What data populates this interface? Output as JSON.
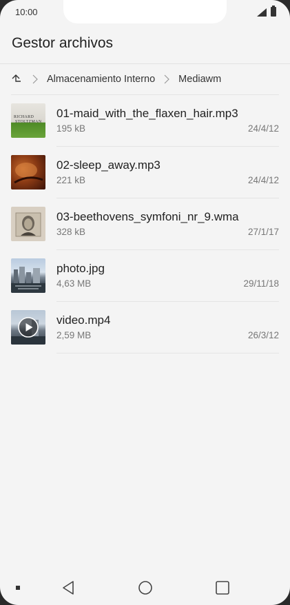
{
  "status": {
    "time": "10:00"
  },
  "header": {
    "title": "Gestor archivos"
  },
  "breadcrumb": {
    "items": [
      "Almacenamiento Interno",
      "Mediawm"
    ]
  },
  "files": [
    {
      "name": "01-maid_with_the_flaxen_hair.mp3",
      "size": "195 kB",
      "date": "24/4/12",
      "thumb_text_1": "RICHARD",
      "thumb_text_2": "STOLTZMAN"
    },
    {
      "name": "02-sleep_away.mp3",
      "size": "221 kB",
      "date": "24/4/12"
    },
    {
      "name": "03-beethovens_symfoni_nr_9.wma",
      "size": "328 kB",
      "date": "27/1/17"
    },
    {
      "name": "photo.jpg",
      "size": "4,63 MB",
      "date": "29/11/18"
    },
    {
      "name": "video.mp4",
      "size": "2,59 MB",
      "date": "26/3/12"
    }
  ]
}
